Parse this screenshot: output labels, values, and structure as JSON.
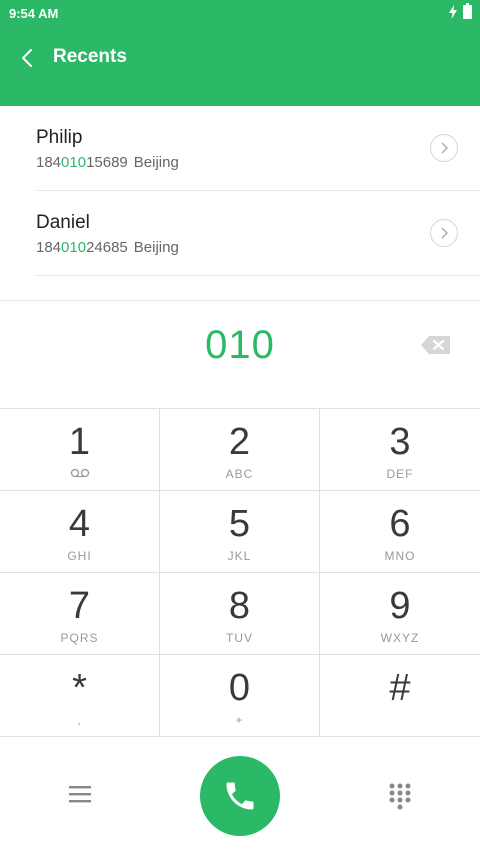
{
  "status_bar": {
    "time": "9:54 AM"
  },
  "app_bar": {
    "title": "Recents"
  },
  "recents": [
    {
      "name": "Philip",
      "number_prefix": "184",
      "number_match": "010",
      "number_suffix": "15689",
      "location": "Beijing"
    },
    {
      "name": "Daniel",
      "number_prefix": "184",
      "number_match": "010",
      "number_suffix": "24685",
      "location": "Beijing"
    }
  ],
  "dial_display": {
    "number": "010"
  },
  "keypad": [
    {
      "digit": "1",
      "letters": ""
    },
    {
      "digit": "2",
      "letters": "ABC"
    },
    {
      "digit": "3",
      "letters": "DEF"
    },
    {
      "digit": "4",
      "letters": "GHI"
    },
    {
      "digit": "5",
      "letters": "JKL"
    },
    {
      "digit": "6",
      "letters": "MNO"
    },
    {
      "digit": "7",
      "letters": "PQRS"
    },
    {
      "digit": "8",
      "letters": "TUV"
    },
    {
      "digit": "9",
      "letters": "WXYZ"
    },
    {
      "digit": "*",
      "letters": ","
    },
    {
      "digit": "0",
      "letters": "+"
    },
    {
      "digit": "#",
      "letters": ""
    }
  ],
  "icons": {
    "back": "chevron-left-icon",
    "info": "chevron-right-icon",
    "delete": "backspace-icon",
    "voicemail": "voicemail-icon",
    "menu": "menu-icon",
    "call": "phone-icon",
    "dialpad": "dialpad-icon"
  },
  "colors": {
    "accent": "#2bb968"
  }
}
